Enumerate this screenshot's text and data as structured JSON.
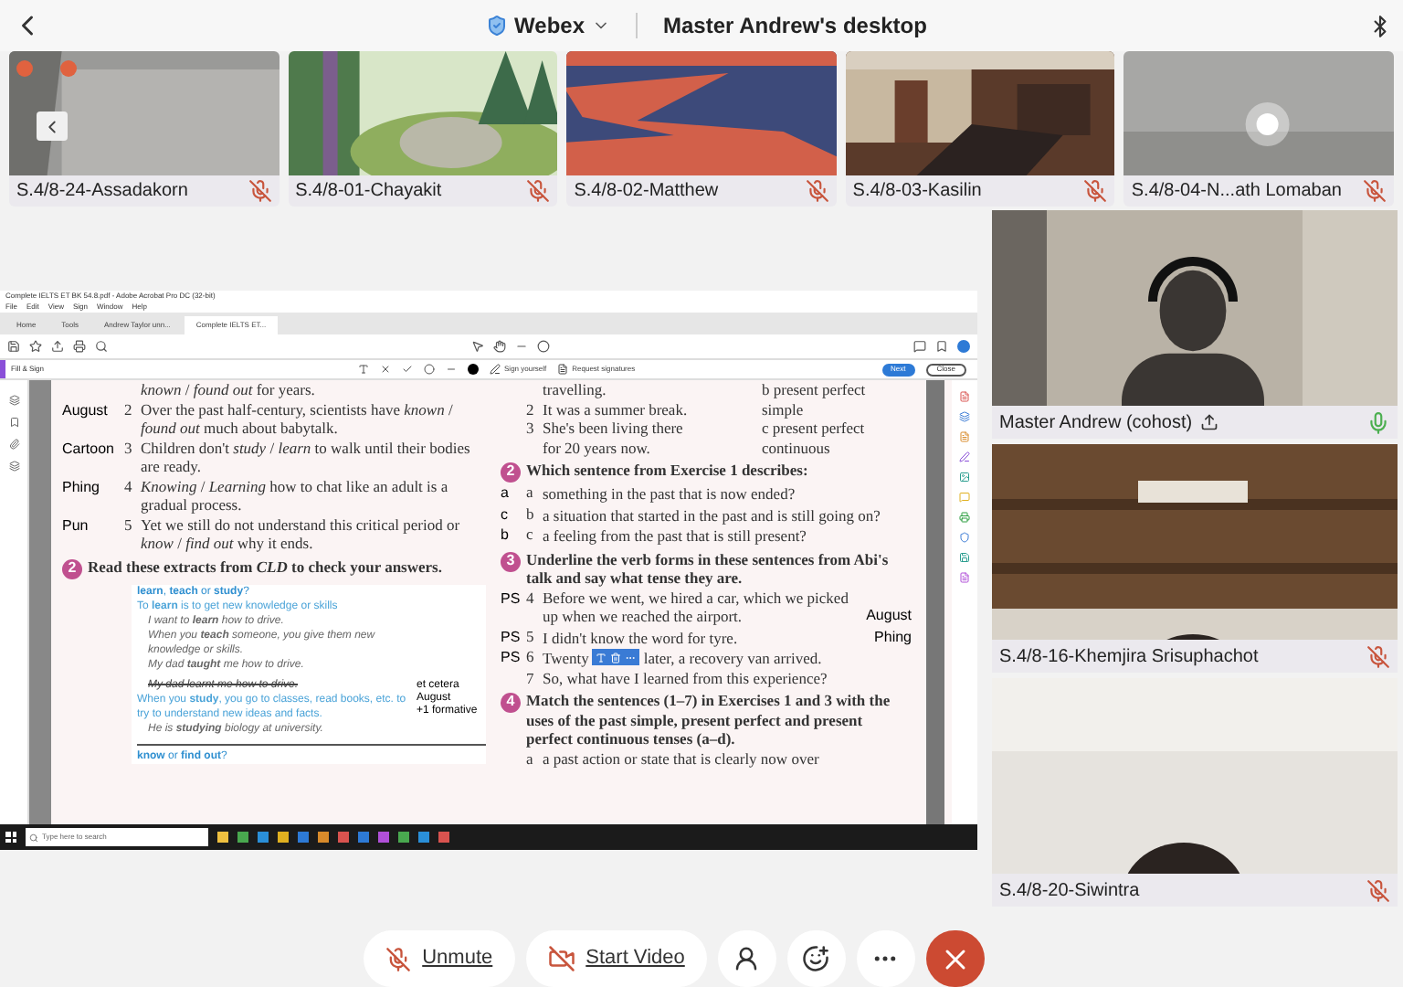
{
  "header": {
    "app": "Webex",
    "title": "Master Andrew's desktop"
  },
  "thumbnails": [
    {
      "name": "S.4/8-24-Assadakorn",
      "muted": true
    },
    {
      "name": "S.4/8-01-Chayakit",
      "muted": true
    },
    {
      "name": "S.4/8-02-Matthew",
      "muted": true
    },
    {
      "name": "S.4/8-03-Kasilin",
      "muted": true
    },
    {
      "name": "S.4/8-04-N...ath Lomaban",
      "muted": true
    }
  ],
  "shared_screen": {
    "window_title": "Complete IELTS ET BK 54.8.pdf - Adobe Acrobat Pro DC (32-bit)",
    "menu": [
      "File",
      "Edit",
      "View",
      "Sign",
      "Window",
      "Help"
    ],
    "tabs": [
      {
        "label": "Home",
        "selected": false
      },
      {
        "label": "Tools",
        "selected": false
      },
      {
        "label": "Andrew Taylor unn...",
        "selected": false
      },
      {
        "label": "Complete IELTS ET...",
        "selected": true
      }
    ],
    "fill_sign": "Fill & Sign",
    "sign_yourself": "Sign yourself",
    "request_signatures": "Request signatures",
    "next": "Next",
    "close": "Close",
    "left_column": [
      {
        "kind": "item",
        "text": "*known* / *found out* for years."
      },
      {
        "kind": "item",
        "note": "August",
        "num": "2",
        "text": "Over the past half-century, scientists have *known* / *found out* much about babytalk."
      },
      {
        "kind": "item",
        "note": "Cartoon",
        "num": "3",
        "text": "Children don't *study* / *learn* to walk until their bodies are ready."
      },
      {
        "kind": "item",
        "note": "Phing",
        "num": "4",
        "text": "*Knowing* / *Learning* how to chat like an adult is a gradual process."
      },
      {
        "kind": "item",
        "note": "Pun",
        "num": "5",
        "text": "Yet we still do not understand this critical period or *know* / *find out* why it ends."
      },
      {
        "kind": "heading",
        "num": "2",
        "text": "Read these extracts from *CLD* to check your answers."
      }
    ],
    "dictionary": {
      "title": "**learn**, **teach** or **study**?",
      "lines": [
        {
          "kind": "def",
          "text": "To **learn** is to get new knowledge or skills"
        },
        {
          "kind": "example",
          "text": "I want to **learn** how to drive."
        },
        {
          "kind": "example",
          "text": "When you **teach** someone, you give them new knowledge or skills."
        },
        {
          "kind": "example",
          "text": "My dad **taught** me how to drive.",
          "struck": "My dad learnt me how to drive."
        },
        {
          "kind": "def",
          "text": "When you **study**, you go to classes, read books, etc. to try to understand new ideas and facts."
        },
        {
          "kind": "example",
          "text": "He is **studying** biology at university."
        }
      ],
      "notes": [
        "et cetera",
        "August",
        "+1 formative"
      ],
      "next_title": "**know** or **find out**?"
    },
    "right_column": [
      {
        "kind": "pair",
        "text": "travelling.",
        "right": "b  present perfect"
      },
      {
        "kind": "pair",
        "num": "2",
        "text": "It was a summer break.",
        "right": "simple"
      },
      {
        "kind": "pair",
        "num": "3",
        "text": "She's been living there",
        "right": "c  present perfect"
      },
      {
        "kind": "pair",
        "text": "for 20 years now.",
        "right": "continuous"
      },
      {
        "kind": "heading",
        "num": "2",
        "text": "Which sentence from Exercise 1 describes:"
      },
      {
        "kind": "item",
        "note": "a",
        "num": "a",
        "text": "something in the past that is now ended?"
      },
      {
        "kind": "item",
        "note": "c",
        "num": "b",
        "text": "a situation that started in the past and is still going on?"
      },
      {
        "kind": "item",
        "note": "b",
        "num": "c",
        "text": "a feeling from the past that is still present?"
      },
      {
        "kind": "heading",
        "num": "3",
        "text": "Underline the verb forms in these sentences from Abi's talk and say what tense they are."
      },
      {
        "kind": "item",
        "note": "PS",
        "num": "4",
        "text": "Before we went, we hired a car, which we picked up when we reached the airport.",
        "after": "August"
      },
      {
        "kind": "item",
        "note": "PS",
        "num": "5",
        "text": "I didn't know the word for tyre.",
        "after": "Phing"
      },
      {
        "kind": "overlay",
        "note": "PS",
        "num": "6",
        "text": "Twenty",
        "text_after": "later, a recovery van arrived."
      },
      {
        "kind": "item",
        "num": "7",
        "text": "So, what have I learned from this experience?"
      },
      {
        "kind": "heading",
        "num": "4",
        "text": "Match the sentences (1–7) in Exercises 1 and 3 with the uses of the past simple, present perfect and present perfect continuous tenses (a–d)."
      },
      {
        "kind": "item",
        "num": "a",
        "text": "a past action or state that is clearly now over"
      }
    ],
    "taskbar_search": "Type here to search"
  },
  "participants": [
    {
      "name": "Master Andrew (cohost)",
      "muted": false,
      "sharing": true
    },
    {
      "name": "S.4/8-16-Khemjira Srisuphachot",
      "muted": true,
      "sharing": false
    },
    {
      "name": "S.4/8-20-Siwintra",
      "muted": true,
      "sharing": false
    }
  ],
  "controls": [
    {
      "kind": "unmute",
      "label": "Unmute"
    },
    {
      "kind": "video",
      "label": "Start Video"
    },
    {
      "kind": "participants"
    },
    {
      "kind": "reactions"
    },
    {
      "kind": "more"
    },
    {
      "kind": "leave"
    }
  ]
}
